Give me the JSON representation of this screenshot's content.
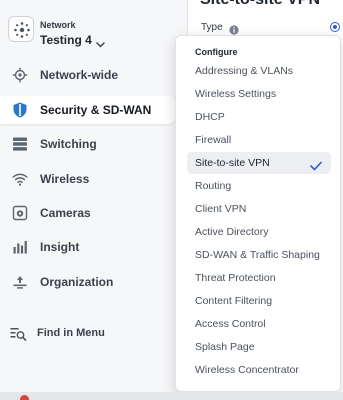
{
  "header": {
    "network_label": "Network",
    "network_name": "Testing 4"
  },
  "sidebar": {
    "items": [
      {
        "label": "Network-wide",
        "icon": "network-wide-icon",
        "active": false
      },
      {
        "label": "Security & SD-WAN",
        "icon": "shield-icon",
        "active": true
      },
      {
        "label": "Switching",
        "icon": "switch-icon",
        "active": false
      },
      {
        "label": "Wireless",
        "icon": "wifi-icon",
        "active": false
      },
      {
        "label": "Cameras",
        "icon": "camera-icon",
        "active": false
      },
      {
        "label": "Insight",
        "icon": "bar-chart-icon",
        "active": false
      },
      {
        "label": "Organization",
        "icon": "organization-icon",
        "active": false
      }
    ],
    "find_menu": "Find in Menu"
  },
  "main": {
    "title": "Site-to-site VPN",
    "type_label": "Type"
  },
  "dropdown": {
    "heading": "Configure",
    "items": [
      "Addressing & VLANs",
      "Wireless Settings",
      "DHCP",
      "Firewall",
      "Site-to-site VPN",
      "Routing",
      "Client VPN",
      "Active Directory",
      "SD-WAN & Traffic Shaping",
      "Threat Protection",
      "Content Filtering",
      "Access Control",
      "Splash Page",
      "Wireless Concentrator"
    ],
    "selected": "Site-to-site VPN"
  },
  "colors": {
    "accent": "#2f5bd8",
    "sidebar_bg": "#f6f7f8",
    "selected_bg": "#eceef1",
    "shield": "#2a79c9"
  }
}
